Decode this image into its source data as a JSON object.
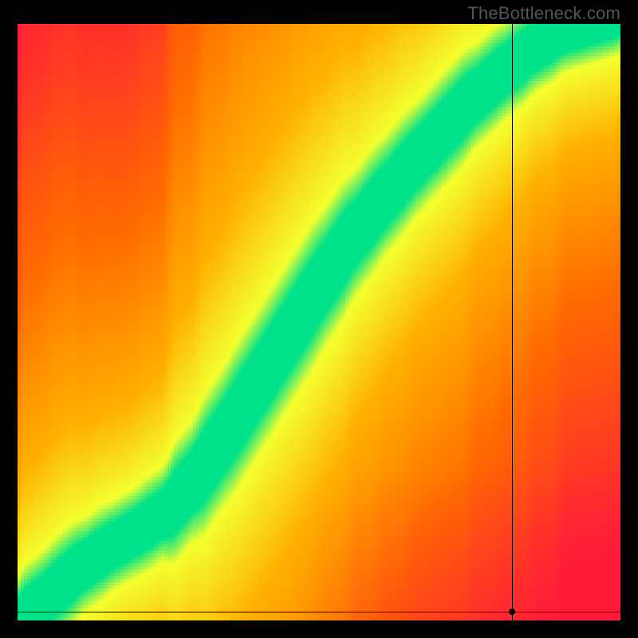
{
  "watermark": "TheBottleneck.com",
  "chart_data": {
    "type": "heatmap",
    "title": "",
    "xlabel": "",
    "ylabel": "",
    "xlim": [
      0,
      1
    ],
    "ylim": [
      0,
      1
    ],
    "legend": false,
    "crosshair": {
      "x": 0.82,
      "y": 0.015
    },
    "optimal_curve": [
      {
        "x": 0.0,
        "y": 0.0
      },
      {
        "x": 0.05,
        "y": 0.04
      },
      {
        "x": 0.1,
        "y": 0.085
      },
      {
        "x": 0.15,
        "y": 0.12
      },
      {
        "x": 0.2,
        "y": 0.15
      },
      {
        "x": 0.25,
        "y": 0.185
      },
      {
        "x": 0.3,
        "y": 0.245
      },
      {
        "x": 0.35,
        "y": 0.32
      },
      {
        "x": 0.4,
        "y": 0.4
      },
      {
        "x": 0.45,
        "y": 0.48
      },
      {
        "x": 0.5,
        "y": 0.56
      },
      {
        "x": 0.55,
        "y": 0.635
      },
      {
        "x": 0.6,
        "y": 0.7
      },
      {
        "x": 0.65,
        "y": 0.76
      },
      {
        "x": 0.7,
        "y": 0.815
      },
      {
        "x": 0.75,
        "y": 0.87
      },
      {
        "x": 0.8,
        "y": 0.915
      },
      {
        "x": 0.85,
        "y": 0.955
      },
      {
        "x": 0.9,
        "y": 0.985
      },
      {
        "x": 0.95,
        "y": 1.0
      }
    ],
    "band_width": 0.055,
    "colors": {
      "optimal": "#00e28a",
      "near": "#f4ff2e",
      "moderate": "#ffb000",
      "far": "#ff6a00",
      "extreme": "#ff1a3a"
    }
  }
}
